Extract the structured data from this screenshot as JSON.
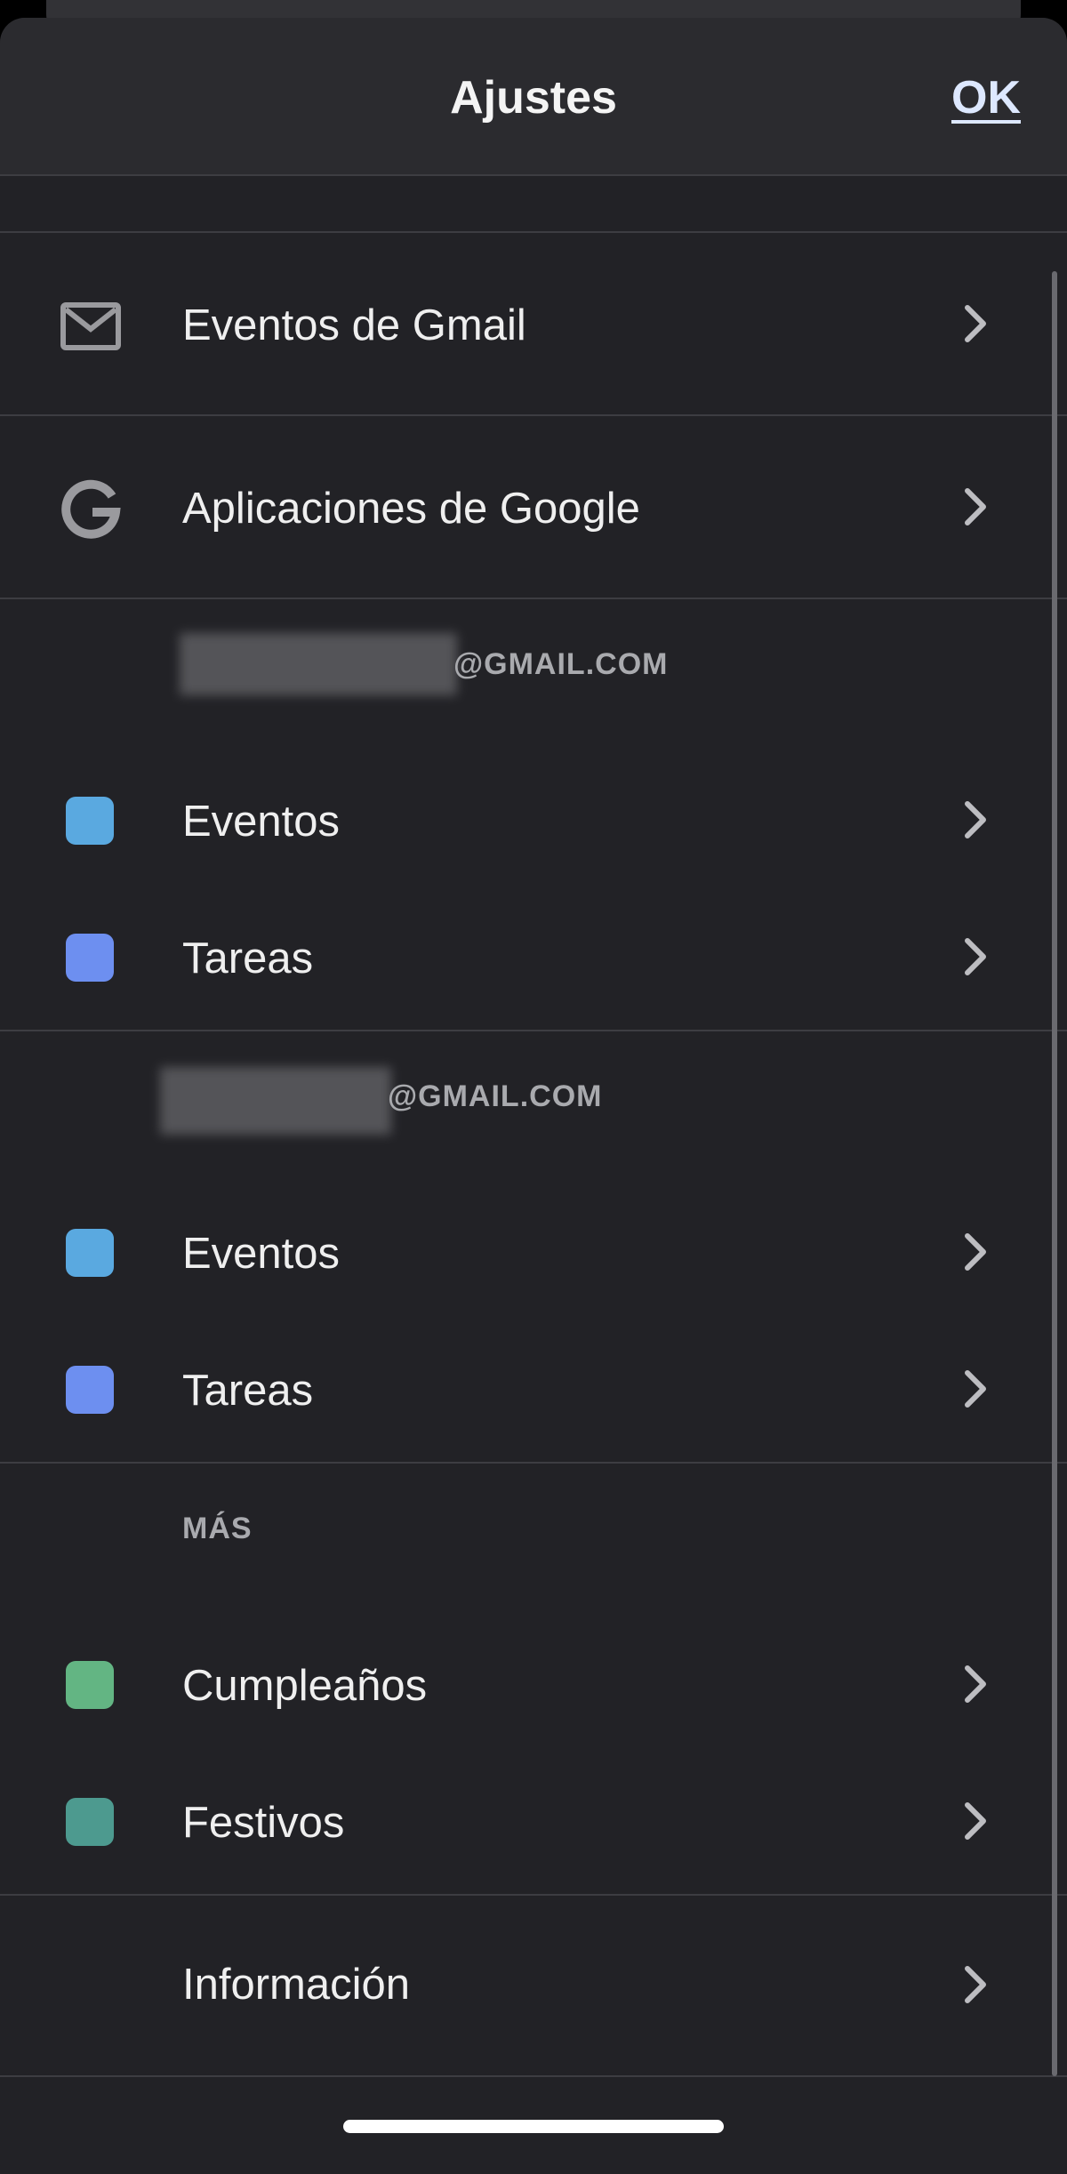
{
  "header": {
    "title": "Ajustes",
    "ok_label": "OK"
  },
  "rows": {
    "gmail_events": {
      "label": "Eventos de Gmail",
      "icon": "mail-icon"
    },
    "google_apps": {
      "label": "Aplicaciones de Google",
      "icon": "google-g-icon"
    }
  },
  "account_1": {
    "email_suffix": "@GMAIL.COM",
    "items": [
      {
        "label": "Eventos",
        "color": "#5aa9e0"
      },
      {
        "label": "Tareas",
        "color": "#6d8ff0"
      }
    ]
  },
  "account_2": {
    "email_suffix": "@GMAIL.COM",
    "items": [
      {
        "label": "Eventos",
        "color": "#5aa9e0"
      },
      {
        "label": "Tareas",
        "color": "#6d8ff0"
      }
    ]
  },
  "more": {
    "header": "MÁS",
    "items": [
      {
        "label": "Cumpleaños",
        "color": "#63b583"
      },
      {
        "label": "Festivos",
        "color": "#4d9a8f"
      }
    ]
  },
  "info": {
    "label": "Información"
  },
  "colors": {
    "background": "#222226",
    "header_background": "#2b2b2f",
    "divider": "#3d3d42",
    "accent_ok": "#dde8ff"
  }
}
